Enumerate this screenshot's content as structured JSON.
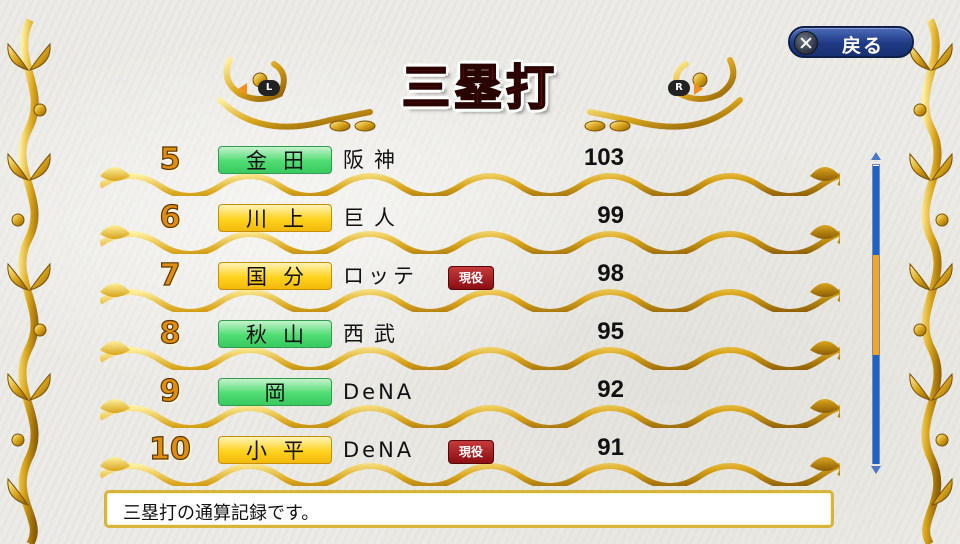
{
  "header": {
    "title": "三塁打",
    "left_button": "L",
    "right_button": "R",
    "back_label": "戻る"
  },
  "rows": [
    {
      "rank": "5",
      "name": "金田",
      "badge_color": "green",
      "team": "阪神",
      "active": "",
      "value": "103"
    },
    {
      "rank": "6",
      "name": "川上",
      "badge_color": "yellow",
      "team": "巨人",
      "active": "",
      "value": "99"
    },
    {
      "rank": "7",
      "name": "国分",
      "badge_color": "yellow",
      "team": "ロッテ",
      "active": "現役",
      "value": "98"
    },
    {
      "rank": "8",
      "name": "秋山",
      "badge_color": "green",
      "team": "西武",
      "active": "",
      "value": "95"
    },
    {
      "rank": "9",
      "name": "岡",
      "badge_color": "green",
      "team": "DeNA",
      "active": "",
      "value": "92"
    },
    {
      "rank": "10",
      "name": "小平",
      "badge_color": "yellow",
      "team": "DeNA",
      "active": "現役",
      "value": "91"
    }
  ],
  "scroll": {
    "position_fraction": 0.45
  },
  "help": {
    "text": "三塁打の通算記録です。"
  },
  "colors": {
    "badge_green": "#4fdc73",
    "badge_yellow": "#ffd21e",
    "title_red": "#e7111a",
    "gold": "#d8a51c",
    "back_button_blue": "#1f3a85"
  }
}
